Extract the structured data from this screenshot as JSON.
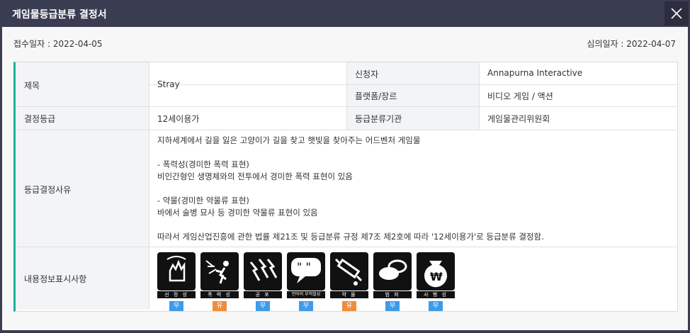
{
  "window": {
    "title": "게임물등급분류 결정서"
  },
  "dates": {
    "received": "접수일자 : 2022-04-05",
    "reviewed": "심의일자 : 2022-04-07"
  },
  "table": {
    "title_label": "제목",
    "title_value": "Stray",
    "applicant_label": "신청자",
    "applicant_value": "Annapurna Interactive",
    "platform_label": "플랫폼/장르",
    "platform_value": "비디오 게임 /  액션",
    "grade_label": "결정등급",
    "grade_value": "12세이용가",
    "agency_label": "등급분류기관",
    "agency_value": "게임물관리위원회",
    "reason_label": "등급결정사유",
    "reason_lines": [
      "지하세계에서 길을 잃은 고양이가 길을 찾고 햇빛을 찾아주는 어드벤처 게임물",
      "",
      "- 폭력성(경미한 폭력 표현)",
      "비인간형인 생명체와의 전투에서 경미한 폭력 표현이 있음",
      "",
      "- 약물(경미한 약물류 표현)",
      "바에서 술병 묘사 등 경미한 약물류 표현이 있음",
      "",
      "따라서 게임산업진흥에 관한 법률 제21조 및 등급분류 규정 제7조 제2호에 따라 '12세이용가'로 등급분류 결정함."
    ],
    "content_label": "내용정보표시사항"
  },
  "descriptors": [
    {
      "icon": "sexuality-icon",
      "label": "선 정 성",
      "status": "무",
      "present": false
    },
    {
      "icon": "violence-icon",
      "label": "폭 력 성",
      "status": "유",
      "present": true
    },
    {
      "icon": "fear-icon",
      "label": "공 포",
      "status": "무",
      "present": false
    },
    {
      "icon": "language-icon",
      "label": "언어의 부적절성",
      "status": "무",
      "present": false
    },
    {
      "icon": "drug-icon",
      "label": "약 물",
      "status": "유",
      "present": true
    },
    {
      "icon": "crime-icon",
      "label": "범 죄",
      "status": "무",
      "present": false
    },
    {
      "icon": "gambling-icon",
      "label": "사 행 성",
      "status": "무",
      "present": false
    }
  ],
  "colors": {
    "accent": "#1fae9a",
    "absent_badge": "#3e9be9",
    "present_badge": "#f08c3c",
    "titlebar": "#3a3d52"
  }
}
